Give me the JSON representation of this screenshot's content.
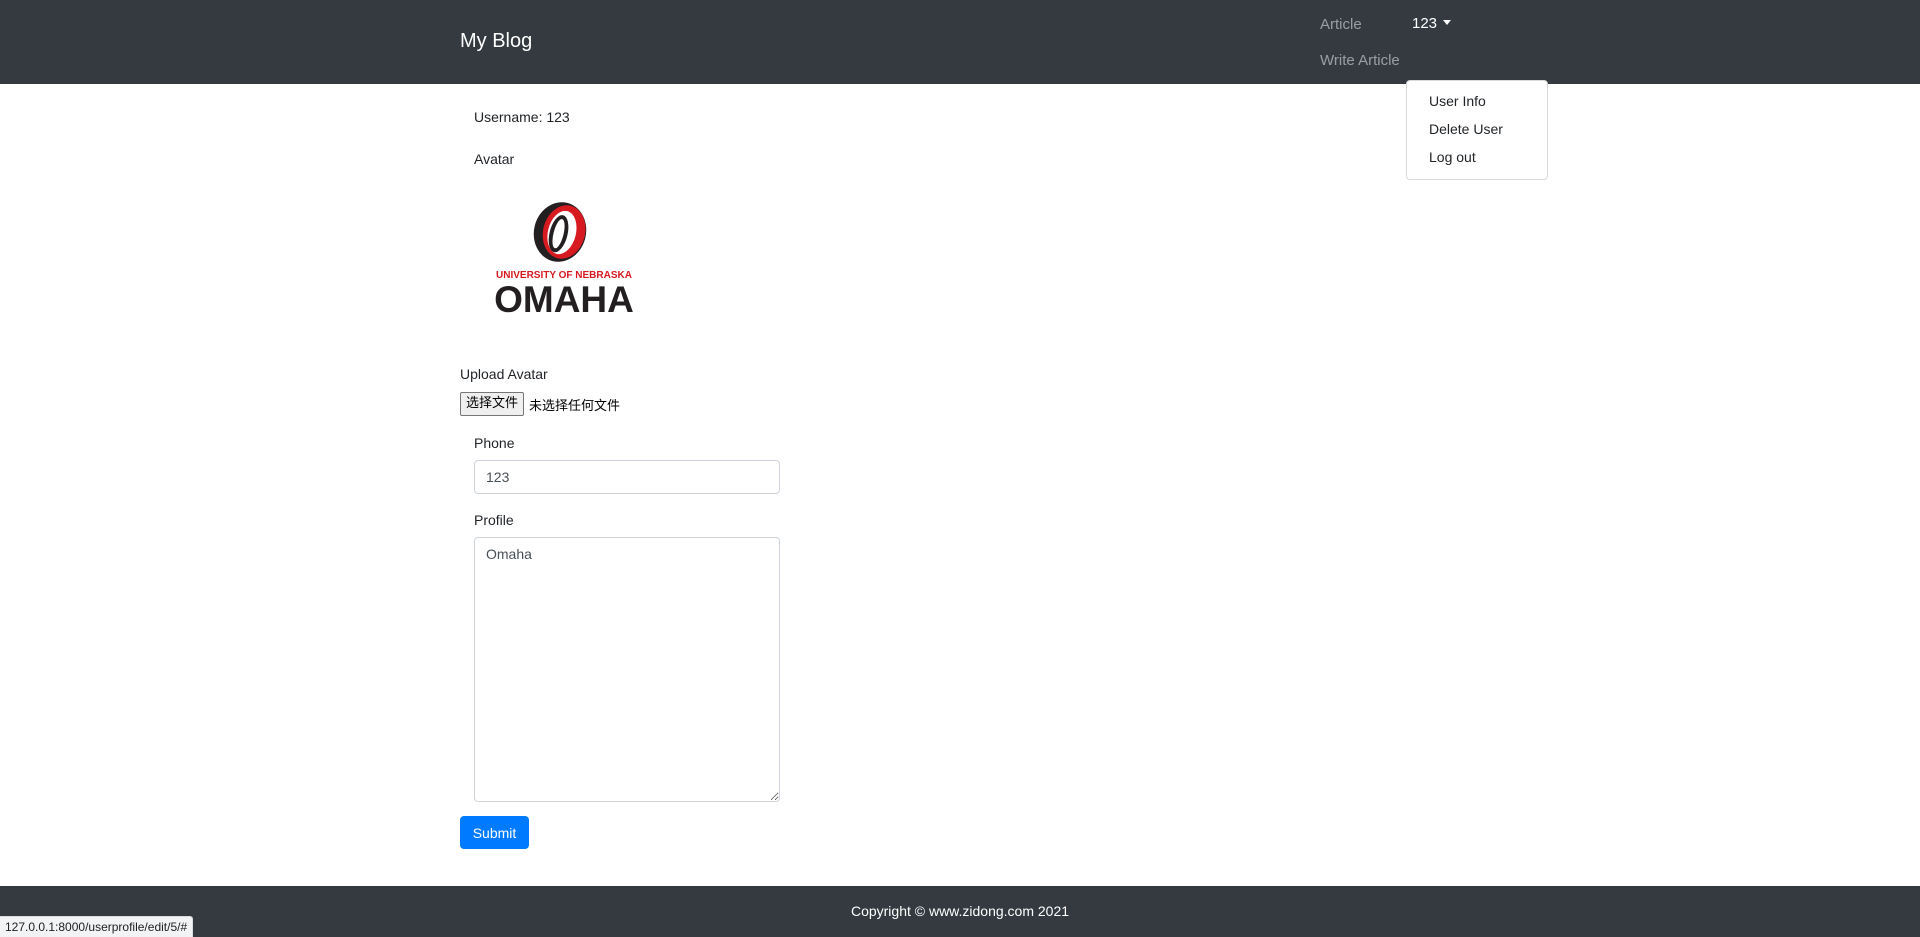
{
  "navbar": {
    "brand": "My Blog",
    "article_link": "Article",
    "write_article_link": "Write Article",
    "user_menu_label": "123"
  },
  "dropdown": {
    "items": [
      "User Info",
      "Delete User",
      "Log out"
    ]
  },
  "main": {
    "username": "Username: 123",
    "avatar_label": "Avatar",
    "avatar_logo": {
      "line1": "UNIVERSITY OF NEBRASKA",
      "line2": "OMAHA"
    },
    "upload_label": "Upload Avatar",
    "file_button": "选择文件",
    "file_status": "未选择任何文件",
    "phone_label": "Phone",
    "phone_value": "123",
    "profile_label": "Profile",
    "profile_value": "Omaha",
    "submit_label": "Submit"
  },
  "footer": {
    "copyright": "Copyright © www.zidong.com 2021"
  },
  "status_bar": {
    "url": "127.0.0.1:8000/userprofile/edit/5/#"
  },
  "colors": {
    "navbar_bg": "#343a40",
    "primary": "#007bff",
    "logo_red": "#d71920",
    "logo_black": "#231f20"
  }
}
